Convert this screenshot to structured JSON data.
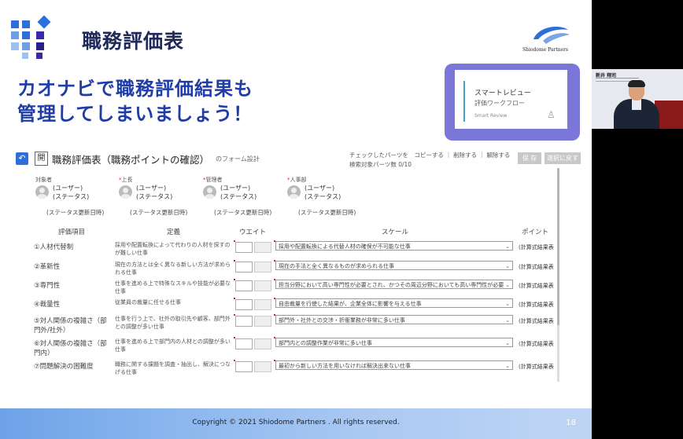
{
  "slide": {
    "title": "職務評価表",
    "headline_line1": "カオナビで職務評価結果も",
    "headline_line2": "管理してしまいましょう！",
    "brand_name": "Shiodome Partners",
    "footer": "Copyright © 2021 Shiodome Partners . All rights reserved.",
    "page_number": "18"
  },
  "popup": {
    "title": "スマートレビュー",
    "subtitle": "評価ワークフロー",
    "caption": "Smart Review"
  },
  "form": {
    "title": "職務評価表（職務ポイントの確認）",
    "subtitle": "のフォーム設計",
    "toolbar_text": "チェックしたパーツを　コピーする ｜ 削除する ｜ 解除する",
    "count_text": "検索対象パーツ数 0/10",
    "save_label": "保 存",
    "back_label": "選択に戻す",
    "open_label": "開",
    "persons": [
      {
        "role": "対象者",
        "required": "",
        "user": "(ユーザー)",
        "status": "(ステータス)",
        "date": "(ステータス更新日時)"
      },
      {
        "role": "上長",
        "required": "*",
        "user": "(ユーザー)",
        "status": "(ステータス)",
        "date": "(ステータス更新日時)"
      },
      {
        "role": "管理者",
        "required": "*",
        "user": "(ユーザー)",
        "status": "(ステータス)",
        "date": "(ステータス更新日時)"
      },
      {
        "role": "人事部",
        "required": "*",
        "user": "(ユーザー)",
        "status": "(ステータス)",
        "date": "(ステータス更新日時)"
      }
    ],
    "headers": {
      "item": "評価項目",
      "definition": "定義",
      "weight": "ウエイト",
      "scale": "スケール",
      "point": "ポイント"
    },
    "rows": [
      {
        "item": "①人材代替制",
        "definition": "採用や配置転換によって代わりの人材を探すのが難しい仕事",
        "scale": "採用や配置転換による代替人材の確保が不可能な仕事",
        "point": "(計算式結果表"
      },
      {
        "item": "②革新性",
        "definition": "現在の方法とは全く異なる新しい方法が求められる仕事",
        "scale": "現在の手法と全く異なるものが求められる仕事",
        "point": "(計算式結果表"
      },
      {
        "item": "③専門性",
        "definition": "仕事を進める上で特殊なスキルや技能が必要な仕事",
        "scale": "担当分野において高い専門性が必要とされ、かつその周辺分野においても高い専門性が必要",
        "point": "(計算式結果表"
      },
      {
        "item": "④裁量性",
        "definition": "従業員の裁量に任せる仕事",
        "scale": "自由裁量を行使した結果が、企業全体に影響を与える仕事",
        "point": "(計算式結果表"
      },
      {
        "item": "⑤対人関係の複雑さ（部門外/社外）",
        "definition": "仕事を行う上で、社外の取引先や顧客、部門外との調整が多い仕事",
        "scale": "部門外・社外との交渉・折衝業務が非常に多い仕事",
        "point": "(計算式結果表"
      },
      {
        "item": "⑥対人関係の複雑さ（部門内）",
        "definition": "仕事を進める上で部門内の人材との調整が多い仕事",
        "scale": "部門内との調整作業が非常に多い仕事",
        "point": "(計算式結果表"
      },
      {
        "item": "⑦問題解決の困難度",
        "definition": "職務に関する課題を調査・抽出し、解決につなげる仕事",
        "scale": "最初から新しい方法を用いなければ解決出来ない仕事",
        "point": "(計算式結果表"
      }
    ]
  },
  "participant": {
    "name": "新井 翔司"
  },
  "colors": {
    "title": "#1f2a5a",
    "headline": "#1f3ca8",
    "popup_frame": "#7b77d9",
    "accent_blue": "#2a6fdb"
  }
}
